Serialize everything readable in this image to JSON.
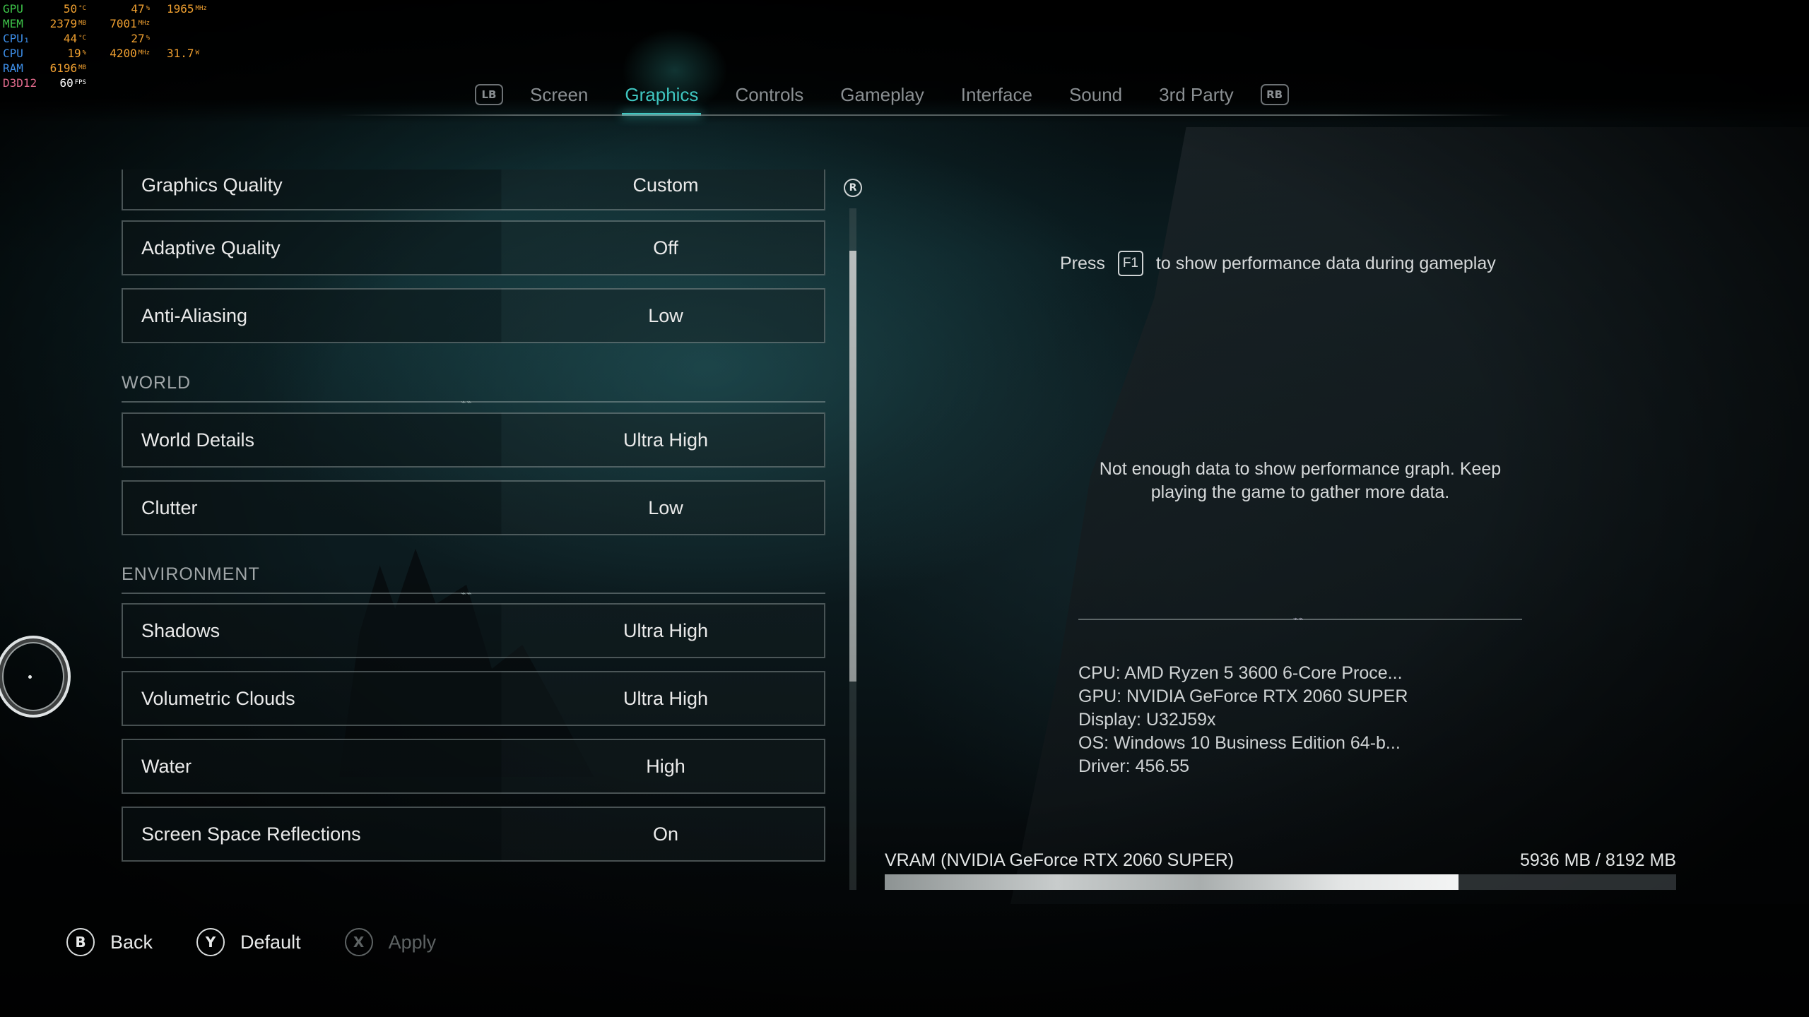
{
  "hud": {
    "rows": [
      {
        "label": "GPU",
        "label_color": "#3ec64a",
        "v1": "50",
        "u1": "°C",
        "v2": "47",
        "u2": "%",
        "v3": "1965",
        "u3": "MHz"
      },
      {
        "label": "MEM",
        "label_color": "#3ec64a",
        "v1": "2379",
        "u1": "MB",
        "v2": "7001",
        "u2": "MHz",
        "v3": "",
        "u3": ""
      },
      {
        "label": "CPU₁",
        "label_color": "#3d8ee8",
        "v1": "44",
        "u1": "°C",
        "v2": "27",
        "u2": "%",
        "v3": "",
        "u3": ""
      },
      {
        "label": "CPU",
        "label_color": "#3d8ee8",
        "v1": "19",
        "u1": "%",
        "v2": "4200",
        "u2": "MHz",
        "v3": "31.7",
        "u3": "W"
      },
      {
        "label": "RAM",
        "label_color": "#3d8ee8",
        "v1": "6196",
        "u1": "MB",
        "v2": "",
        "u2": "",
        "v3": "",
        "u3": ""
      },
      {
        "label": "D3D12",
        "label_color": "#e06a8c",
        "v1": "60",
        "u1": "FPS",
        "v2": "",
        "u2": "",
        "v3": "",
        "u3": ""
      }
    ],
    "value_color": "#f0a030",
    "fps_color": "#ffffff"
  },
  "tabs": {
    "left_bumper": "LB",
    "right_bumper": "RB",
    "items": [
      {
        "label": "Screen",
        "active": false
      },
      {
        "label": "Graphics",
        "active": true
      },
      {
        "label": "Controls",
        "active": false
      },
      {
        "label": "Gameplay",
        "active": false
      },
      {
        "label": "Interface",
        "active": false
      },
      {
        "label": "Sound",
        "active": false
      },
      {
        "label": "3rd Party",
        "active": false
      }
    ],
    "accent_color": "#3fc6c0"
  },
  "settings": {
    "graphics_quality": {
      "label": "Graphics Quality",
      "value": "Custom"
    },
    "adaptive_quality": {
      "label": "Adaptive Quality",
      "value": "Off"
    },
    "anti_aliasing": {
      "label": "Anti-Aliasing",
      "value": "Low"
    },
    "section_world": "WORLD",
    "world_details": {
      "label": "World Details",
      "value": "Ultra High"
    },
    "clutter": {
      "label": "Clutter",
      "value": "Low"
    },
    "section_environment": "ENVIRONMENT",
    "shadows": {
      "label": "Shadows",
      "value": "Ultra High"
    },
    "volumetric_clouds": {
      "label": "Volumetric Clouds",
      "value": "Ultra High"
    },
    "water": {
      "label": "Water",
      "value": "High"
    },
    "ssr": {
      "label": "Screen Space Reflections",
      "value": "On"
    }
  },
  "scroll": {
    "icon_label": "R"
  },
  "info": {
    "press_prefix": "Press",
    "press_key": "F1",
    "press_suffix": "to show performance data during gameplay",
    "graph_message": "Not enough data to show performance graph. Keep playing the game to gather more data.",
    "cpu": "CPU: AMD Ryzen 5 3600 6-Core Proce...",
    "gpu": "GPU: NVIDIA GeForce RTX 2060 SUPER",
    "display": "Display: U32J59x",
    "os": "OS: Windows 10 Business Edition 64-b...",
    "driver": "Driver: 456.55"
  },
  "vram": {
    "label": "VRAM (NVIDIA GeForce RTX 2060 SUPER)",
    "value_text": "5936 MB / 8192 MB",
    "used_mb": 5936,
    "total_mb": 8192
  },
  "footer": {
    "back": {
      "key": "B",
      "label": "Back"
    },
    "default": {
      "key": "Y",
      "label": "Default"
    },
    "apply": {
      "key": "X",
      "label": "Apply"
    }
  }
}
